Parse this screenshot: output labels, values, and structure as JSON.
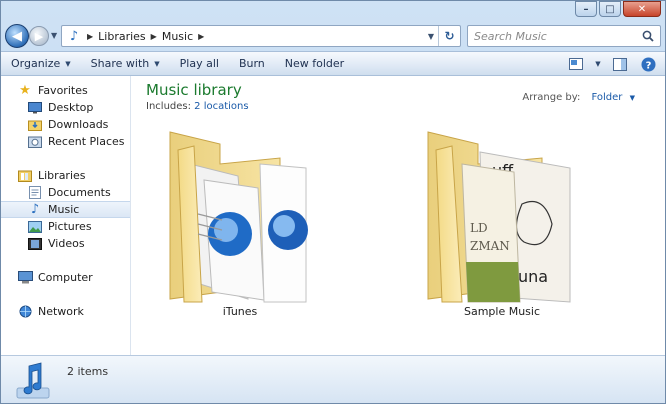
{
  "window": {
    "controls": {
      "minimize": "–",
      "maximize": "□",
      "close": "✕"
    }
  },
  "address_bar": {
    "crumbs": [
      "Libraries",
      "Music"
    ],
    "folder_icon": "music-library-icon"
  },
  "search": {
    "placeholder": "Search Music"
  },
  "toolbar": {
    "organize": "Organize",
    "share_with": "Share with",
    "play_all": "Play all",
    "burn": "Burn",
    "new_folder": "New folder"
  },
  "sidebar": {
    "favorites": {
      "label": "Favorites",
      "items": [
        "Desktop",
        "Downloads",
        "Recent Places"
      ]
    },
    "libraries": {
      "label": "Libraries",
      "items": [
        "Documents",
        "Music",
        "Pictures",
        "Videos"
      ]
    },
    "computer": "Computer",
    "network": "Network",
    "selected": "Music"
  },
  "library": {
    "title": "Music library",
    "includes_label": "Includes:",
    "includes_link": "2 locations",
    "arrange_label": "Arrange by:",
    "arrange_value": "Folder"
  },
  "folders": [
    {
      "name": "iTunes"
    },
    {
      "name": "Sample Music"
    }
  ],
  "status": {
    "count": "2 items"
  },
  "colors": {
    "title_green": "#1b7a2e",
    "link_blue": "#1a5aa8",
    "chrome_blue": "#c9dcef"
  }
}
